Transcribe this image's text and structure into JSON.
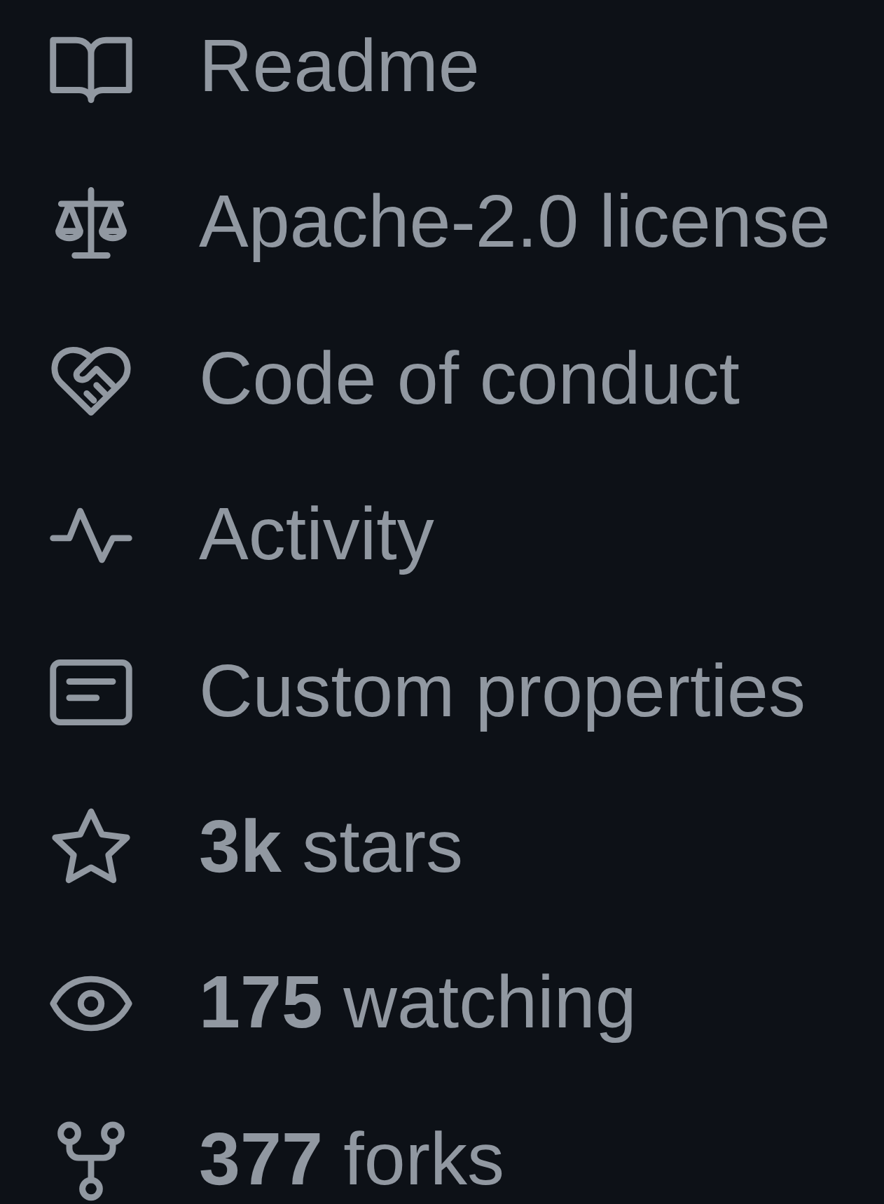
{
  "sidebar": {
    "items": [
      {
        "text": "Readme"
      },
      {
        "text": "Apache-2.0 license"
      },
      {
        "text": "Code of conduct"
      },
      {
        "text": "Activity"
      },
      {
        "text": "Custom properties"
      },
      {
        "text": "**3k** stars"
      },
      {
        "text": "**175** watching"
      },
      {
        "text": "**377** forks"
      }
    ]
  }
}
